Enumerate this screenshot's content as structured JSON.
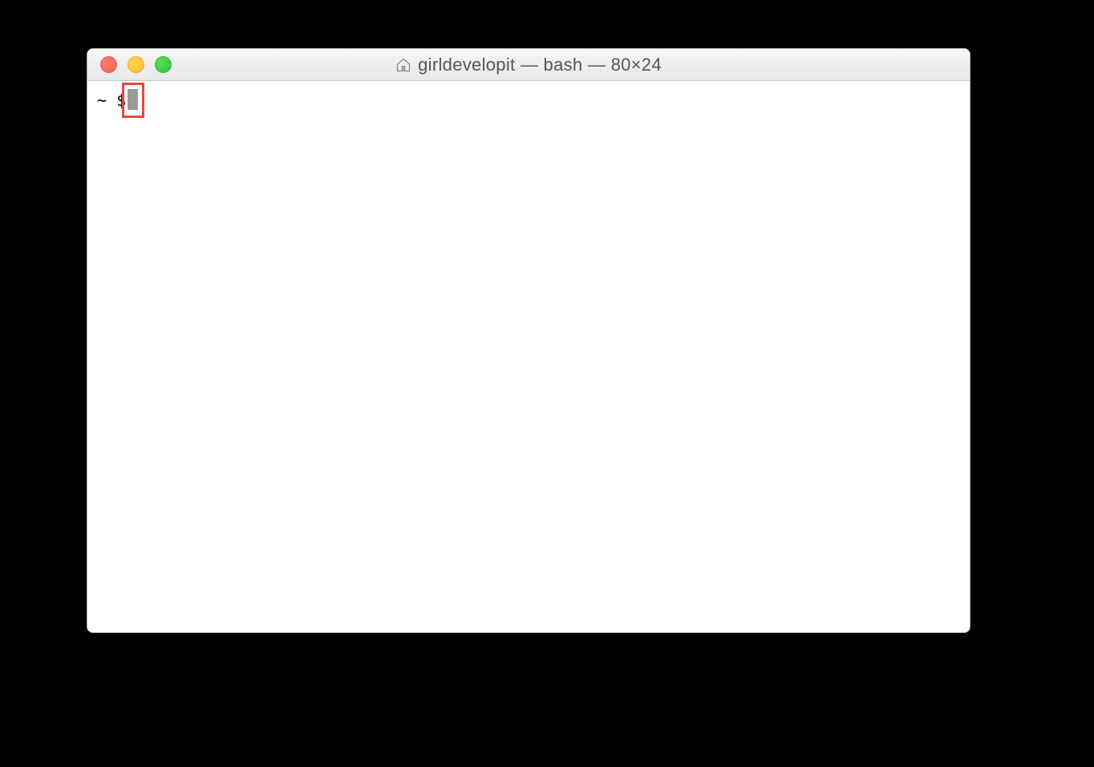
{
  "window": {
    "title": "girldevelopit — bash — 80×24",
    "icon": "home-icon"
  },
  "traffic_lights": {
    "close_color": "#ff5f57",
    "minimize_color": "#ffbd2e",
    "zoom_color": "#28c940"
  },
  "terminal": {
    "prompt": "~ $",
    "cursor_color": "#9a9a9a",
    "highlight_color": "#e04a3f"
  }
}
